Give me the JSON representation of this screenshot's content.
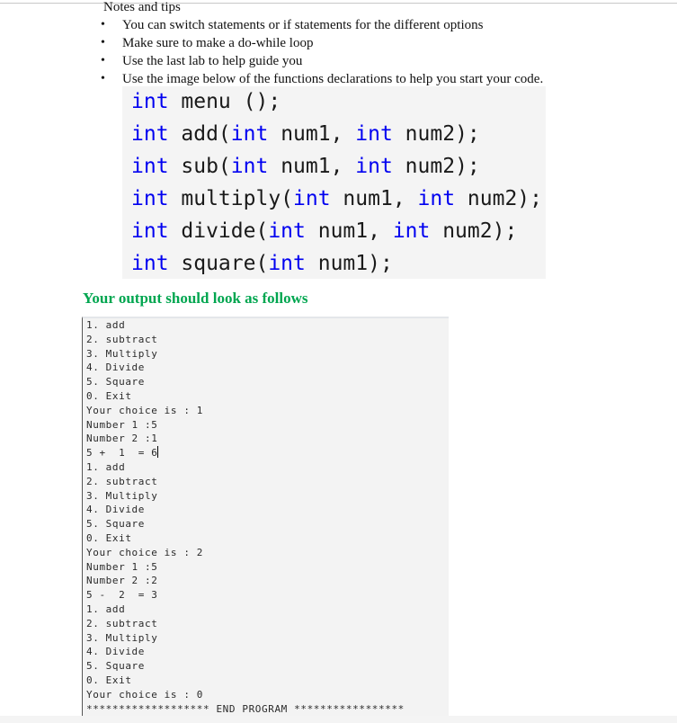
{
  "notes": {
    "title": "Notes and tips",
    "bullets": [
      "You can switch statements or if statements for the different options",
      "Make sure to make a do-while loop",
      "Use the last lab to help guide you",
      "Use the image below of the functions declarations to help you start your code."
    ],
    "bullet_glyph": "•"
  },
  "code": {
    "keyword_color": "#0000f0",
    "lines": [
      [
        {
          "t": "int",
          "kw": true
        },
        {
          "t": " menu ();"
        }
      ],
      [
        {
          "t": "int",
          "kw": true
        },
        {
          "t": " add("
        },
        {
          "t": "int",
          "kw": true
        },
        {
          "t": " num1, "
        },
        {
          "t": "int",
          "kw": true
        },
        {
          "t": " num2);"
        }
      ],
      [
        {
          "t": "int",
          "kw": true
        },
        {
          "t": " sub("
        },
        {
          "t": "int",
          "kw": true
        },
        {
          "t": " num1, "
        },
        {
          "t": "int",
          "kw": true
        },
        {
          "t": " num2);"
        }
      ],
      [
        {
          "t": "int",
          "kw": true
        },
        {
          "t": " multiply("
        },
        {
          "t": "int",
          "kw": true
        },
        {
          "t": " num1, "
        },
        {
          "t": "int",
          "kw": true
        },
        {
          "t": " num2);"
        }
      ],
      [
        {
          "t": "int",
          "kw": true
        },
        {
          "t": " divide("
        },
        {
          "t": "int",
          "kw": true
        },
        {
          "t": " num1, "
        },
        {
          "t": "int",
          "kw": true
        },
        {
          "t": " num2);"
        }
      ],
      [
        {
          "t": "int",
          "kw": true
        },
        {
          "t": " square("
        },
        {
          "t": "int",
          "kw": true
        },
        {
          "t": " num1);"
        }
      ]
    ]
  },
  "output_heading": {
    "text": "Your output should look as follows",
    "color": "#00a650"
  },
  "console": {
    "lines": [
      "1. add",
      "2. subtract",
      "3. Multiply",
      "4. Divide",
      "5. Square",
      "0. Exit",
      "Your choice is : 1",
      "Number 1 :5",
      "Number 2 :1",
      "5 +  1  = 6",
      "1. add",
      "2. subtract",
      "3. Multiply",
      "4. Divide",
      "5. Square",
      "0. Exit",
      "Your choice is : 2",
      "Number 1 :5",
      "Number 2 :2",
      "5 -  2  = 3",
      "1. add",
      "2. subtract",
      "3. Multiply",
      "4. Divide",
      "5. Square",
      "0. Exit",
      "Your choice is : 0",
      "******************* END PROGRAM *****************"
    ],
    "cursor_after_line": 9
  }
}
